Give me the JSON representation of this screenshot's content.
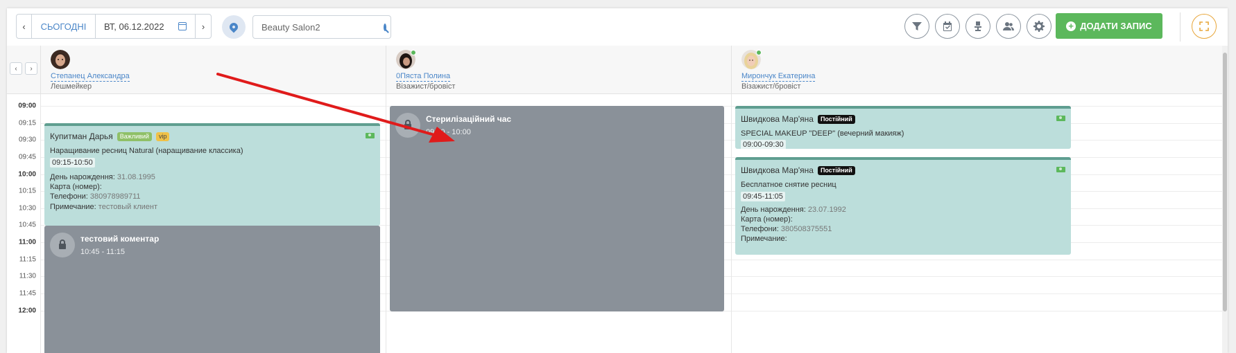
{
  "toolbar": {
    "prev_icon": "chevron-left-icon",
    "today_label": "СЬОГОДНІ",
    "date_value": "ВТ, 06.12.2022",
    "next_icon": "chevron-right-icon",
    "location_icon": "map-pin-icon",
    "search_value": "Beauty Salon2",
    "actions": [
      "filter-icon",
      "calendar-check-icon",
      "chair-icon",
      "users-icon",
      "gear-icon"
    ],
    "add_label": "ДОДАТИ ЗАПИС",
    "expand_icon": "fullscreen-icon",
    "colors": {
      "primary": "#4a86c8",
      "add": "#5cb85c",
      "expand": "#e8a63a"
    }
  },
  "staff": [
    {
      "name": "Степанец Александра",
      "role": "Лешмейкер",
      "online": false
    },
    {
      "name": "0Пяста Полина",
      "role": "Візажист/бровіст",
      "online": true
    },
    {
      "name": "Мирончук Екатерина",
      "role": "Візажист/бровіст",
      "online": true
    }
  ],
  "times": [
    "09:00",
    "09:15",
    "09:30",
    "09:45",
    "10:00",
    "10:15",
    "10:30",
    "10:45",
    "11:00",
    "11:15",
    "11:30",
    "11:45",
    "12:00"
  ],
  "appointments": {
    "kupitman": {
      "client": "Купитман Дарья",
      "badges": [
        "Важливий",
        "vip"
      ],
      "service": "Наращивание ресниц Natural (наращивание классика)",
      "time": "09:15-10:50",
      "birthday_label": "День нарождення:",
      "birthday": "31.08.1995",
      "card_label": "Карта (номер):",
      "card": "",
      "phone_label": "Телефони:",
      "phone": "380978989711",
      "note_label": "Примечание:",
      "note": "тестовый клиент"
    },
    "comment_block": {
      "title": "тестовий коментар",
      "time": "10:45 - 11:15"
    },
    "sterilization_block": {
      "title": "Стерилізаційний час",
      "time": "09:00 - 10:00"
    },
    "shvydkova1": {
      "client": "Швидкова Мар'яна",
      "badge": "Постійний",
      "service": "SPECIAL MAKEUP \"DEEP\" (вечерний макияж)",
      "time": "09:00-09:30"
    },
    "shvydkova2": {
      "client": "Швидкова Мар'яна",
      "badge": "Постійний",
      "service": "Бесплатное снятие ресниц",
      "time": "09:45-11:05",
      "birthday_label": "День нарождення:",
      "birthday": "23.07.1992",
      "card_label": "Карта (номер):",
      "card": "",
      "phone_label": "Телефони:",
      "phone": "380508375551",
      "note_label": "Примечание:",
      "note": ""
    }
  },
  "colors": {
    "appointment_bg": "#bcdedb",
    "appointment_top": "#5f9e90",
    "block_bg": "#8a9199",
    "arrow": "#e01b1b"
  }
}
